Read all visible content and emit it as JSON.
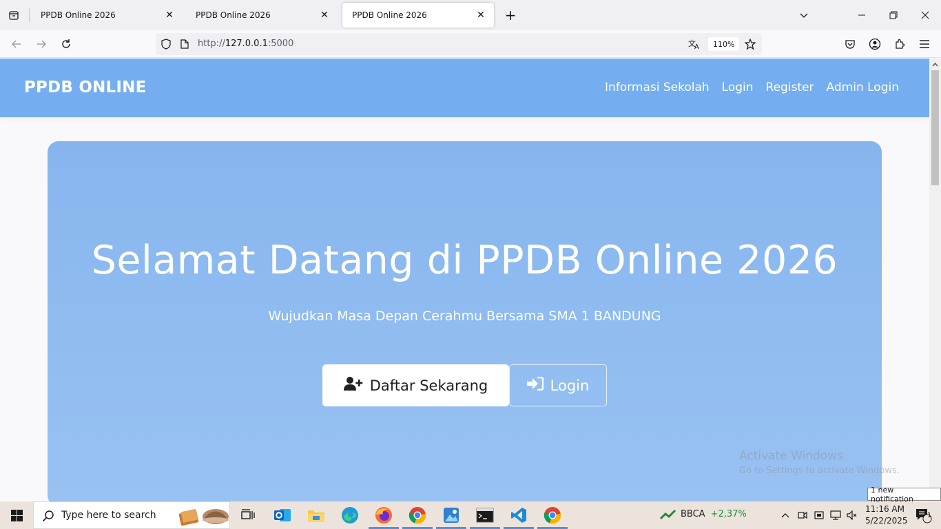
{
  "browser": {
    "tabs": [
      {
        "title": "PPDB Online 2026",
        "active": false
      },
      {
        "title": "PPDB Online 2026",
        "active": false
      },
      {
        "title": "PPDB Online 2026",
        "active": true
      }
    ],
    "new_tab_symbol": "+",
    "url_prefix": "http://",
    "url_host": "127.0.0.1",
    "url_port": ":5000",
    "zoom": "110%"
  },
  "site": {
    "brand": "PPDB ONLINE",
    "nav": [
      "Informasi Sekolah",
      "Login",
      "Register",
      "Admin Login"
    ],
    "hero_title": "Selamat Datang di PPDB Online 2026",
    "hero_subtitle": "Wujudkan Masa Depan Cerahmu Bersama SMA 1 BANDUNG",
    "primary_button": "Daftar Sekarang",
    "secondary_button": "Login"
  },
  "watermark": {
    "line1": "Activate Windows",
    "line2": "Go to Settings to activate Windows."
  },
  "notification_toast": "1 new notification",
  "taskbar": {
    "search_placeholder": "Type here to search",
    "stock_symbol": "BBCA",
    "stock_change": "+2,37%",
    "time": "11:16 AM",
    "date": "5/22/2025",
    "notification_count": "1",
    "accent_color": "#5a8fd6"
  },
  "colors": {
    "header": "#74aef0",
    "hero": "#8fbaf0"
  }
}
